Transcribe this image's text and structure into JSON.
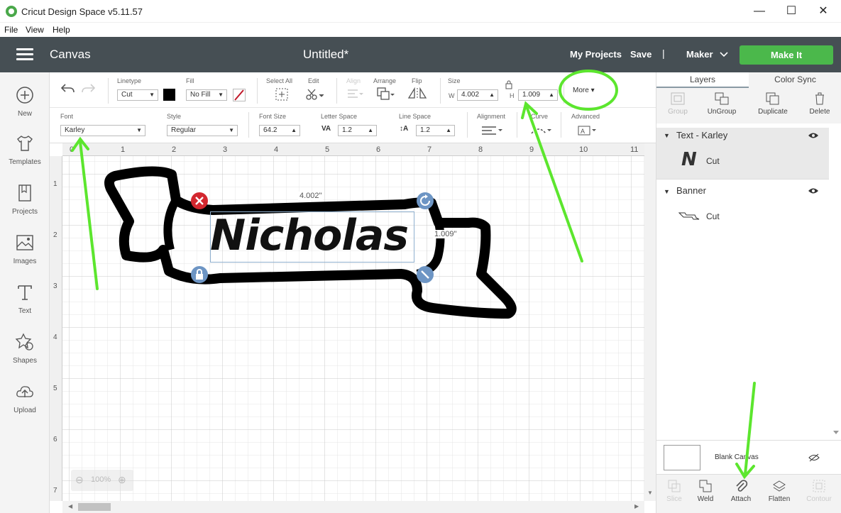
{
  "app": {
    "title": "Cricut Design Space  v5.11.57",
    "win_min": "—",
    "win_max": "☐",
    "win_close": "✕"
  },
  "menu": {
    "file": "File",
    "view": "View",
    "help": "Help"
  },
  "header": {
    "canvas": "Canvas",
    "doc_title": "Untitled*",
    "my_projects": "My Projects",
    "save": "Save",
    "sep": "|",
    "machine": "Maker",
    "make_it": "Make It",
    "accent": "#4bb84b"
  },
  "leftbar": [
    {
      "label": "New",
      "icon": "plus-circle-icon"
    },
    {
      "label": "Templates",
      "icon": "tshirt-icon"
    },
    {
      "label": "Projects",
      "icon": "bookmark-icon"
    },
    {
      "label": "Images",
      "icon": "image-icon"
    },
    {
      "label": "Text",
      "icon": "text-t-icon"
    },
    {
      "label": "Shapes",
      "icon": "shapes-icon"
    },
    {
      "label": "Upload",
      "icon": "upload-cloud-icon"
    }
  ],
  "toolbar": {
    "linetype_label": "Linetype",
    "linetype_value": "Cut",
    "fill_label": "Fill",
    "fill_value": "No Fill",
    "select_all": "Select All",
    "edit": "Edit",
    "align": "Align",
    "arrange": "Arrange",
    "flip": "Flip",
    "size": "Size",
    "w_label": "W",
    "w_value": "4.002",
    "h_label": "H",
    "h_value": "1.009",
    "more": "More",
    "font_label": "Font",
    "font_value": "Karley",
    "style_label": "Style",
    "style_value": "Regular",
    "font_size_label": "Font Size",
    "font_size_value": "64.2",
    "letter_space_label": "Letter Space",
    "letter_space_value": "1.2",
    "line_space_label": "Line Space",
    "line_space_value": "1.2",
    "alignment_label": "Alignment",
    "curve_label": "Curve",
    "advanced_label": "Advanced"
  },
  "canvas": {
    "ruler_top": [
      "0",
      "1",
      "2",
      "3",
      "4",
      "5",
      "6",
      "7",
      "8",
      "9",
      "10",
      "11"
    ],
    "ruler_left": [
      "1",
      "2",
      "3",
      "4",
      "5",
      "6",
      "7"
    ],
    "text": "Nicholas",
    "dim_w": "4.002\"",
    "dim_h": "1.009\"",
    "zoom": "100%"
  },
  "rightpanel": {
    "tab_layers": "Layers",
    "tab_color_sync": "Color Sync",
    "group": "Group",
    "ungroup": "UnGroup",
    "duplicate": "Duplicate",
    "delete": "Delete",
    "layer1_name": "Text - Karley",
    "layer1_glyph": "N",
    "layer1_op": "Cut",
    "layer2_name": "Banner",
    "layer2_op": "Cut",
    "blank_canvas": "Blank Canvas",
    "slice": "Slice",
    "weld": "Weld",
    "attach": "Attach",
    "flatten": "Flatten",
    "contour": "Contour"
  },
  "annotation_color": "#5ce62e"
}
